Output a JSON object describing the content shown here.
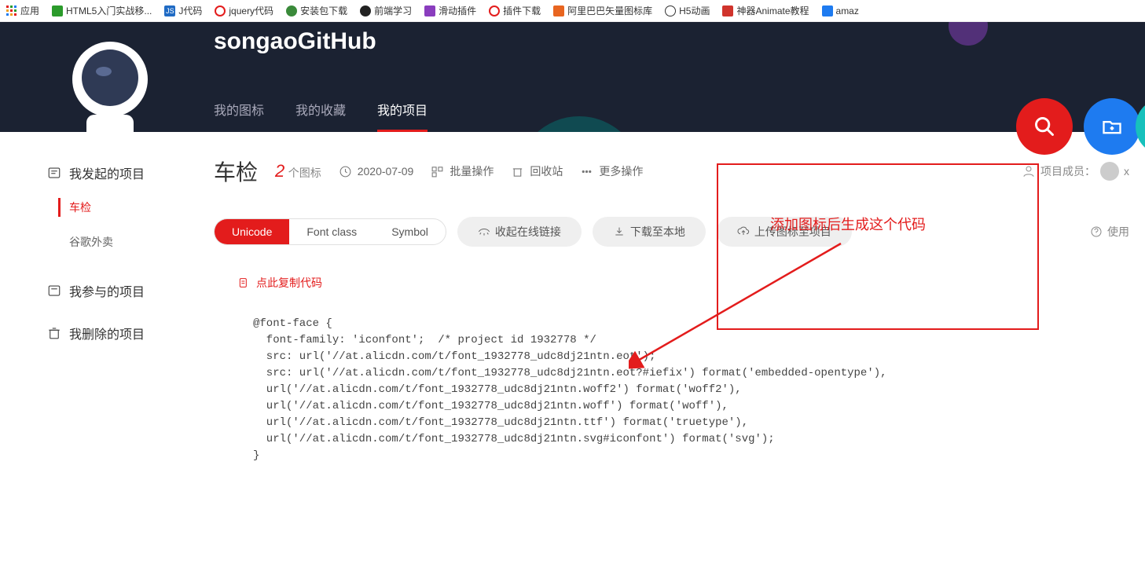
{
  "bookmarks": {
    "apps": "应用",
    "items": [
      "HTML5入门实战移...",
      "J代码",
      "jquery代码",
      "安装包下载",
      "前端学习",
      "滑动插件",
      "插件下载",
      "阿里巴巴矢量图标库",
      "H5动画",
      "神器Animate教程",
      "amaz"
    ]
  },
  "hero": {
    "title": "songaoGitHub",
    "tabs": {
      "icons": "我的图标",
      "favorites": "我的收藏",
      "projects": "我的项目"
    }
  },
  "sidebar": {
    "myCreated": "我发起的项目",
    "cheJian": "车检",
    "googleFood": "谷歌外卖",
    "participated": "我参与的项目",
    "deleted": "我删除的项目"
  },
  "project": {
    "name": "车检",
    "count": "2",
    "countLabel": "个图标",
    "date": "2020-07-09",
    "batch": "批量操作",
    "recycle": "回收站",
    "more": "更多操作",
    "memberLabel": "项目成员：",
    "memberInitial": "x"
  },
  "toolbar": {
    "unicode": "Unicode",
    "fontclass": "Font class",
    "symbol": "Symbol",
    "collapseLink": "收起在线链接",
    "download": "下载至本地",
    "upload": "上传图标至项目",
    "help": "使用"
  },
  "annotation": "添加图标后生成这个代码",
  "copyHint": "点此复制代码",
  "code": "@font-face {\n  font-family: 'iconfont';  /* project id 1932778 */\n  src: url('//at.alicdn.com/t/font_1932778_udc8dj21ntn.eot');\n  src: url('//at.alicdn.com/t/font_1932778_udc8dj21ntn.eot?#iefix') format('embedded-opentype'),\n  url('//at.alicdn.com/t/font_1932778_udc8dj21ntn.woff2') format('woff2'),\n  url('//at.alicdn.com/t/font_1932778_udc8dj21ntn.woff') format('woff'),\n  url('//at.alicdn.com/t/font_1932778_udc8dj21ntn.ttf') format('truetype'),\n  url('//at.alicdn.com/t/font_1932778_udc8dj21ntn.svg#iconfont') format('svg');\n}"
}
